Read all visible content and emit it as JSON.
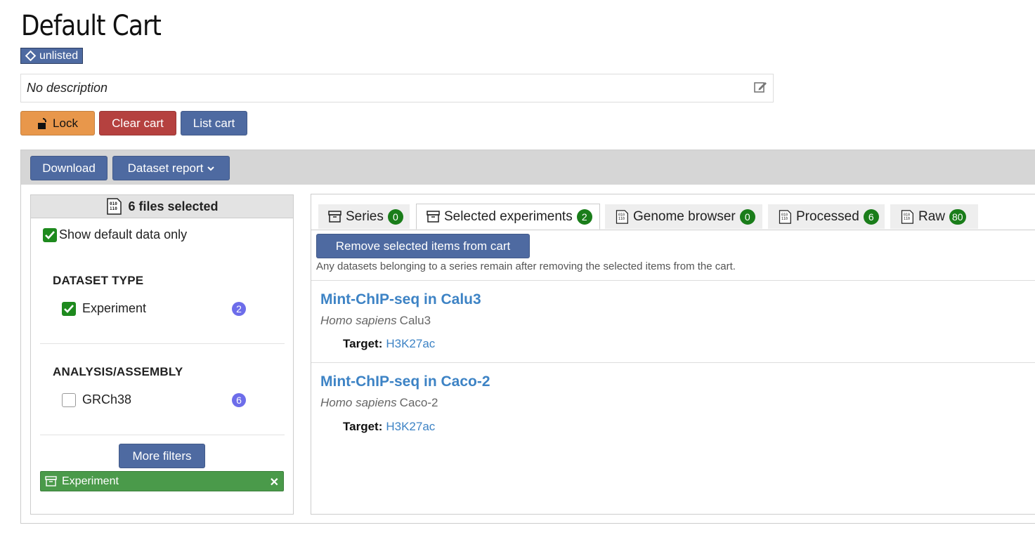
{
  "page": {
    "title": "Default Cart",
    "status": "unlisted",
    "description": "No description"
  },
  "actions": {
    "lock": "Lock",
    "clear": "Clear cart",
    "list": "List cart"
  },
  "toolbar": {
    "download": "Download",
    "dataset_report": "Dataset report"
  },
  "facets": {
    "files_selected": "6 files selected",
    "default_only_label": "Show default data only",
    "dataset_type": {
      "title": "DATASET TYPE",
      "items": [
        {
          "label": "Experiment",
          "count": "2",
          "checked": true
        }
      ]
    },
    "analysis": {
      "title": "ANALYSIS/ASSEMBLY",
      "items": [
        {
          "label": "GRCh38",
          "count": "6",
          "checked": false
        }
      ]
    },
    "more_filters": "More filters",
    "active_filter": "Experiment"
  },
  "tabs": [
    {
      "label": "Series",
      "count": "0",
      "icon": "archive-box-icon"
    },
    {
      "label": "Selected experiments",
      "count": "2",
      "icon": "archive-box-icon",
      "active": true
    },
    {
      "label": "Genome browser",
      "count": "0",
      "icon": "binary-file-icon"
    },
    {
      "label": "Processed",
      "count": "6",
      "icon": "binary-file-icon"
    },
    {
      "label": "Raw",
      "count": "80",
      "icon": "binary-file-icon"
    }
  ],
  "results": {
    "remove_button": "Remove selected items from cart",
    "note": "Any datasets belonging to a series remain after removing the selected items from the cart.",
    "target_label": "Target:",
    "items": [
      {
        "title": "Mint-ChIP-seq in Calu3",
        "organism": "Homo sapiens",
        "biosample": "Calu3",
        "target": "H3K27ac"
      },
      {
        "title": "Mint-ChIP-seq in Caco-2",
        "organism": "Homo sapiens",
        "biosample": "Caco-2",
        "target": "H3K27ac"
      }
    ]
  },
  "colors": {
    "primary": "#4e6aa1",
    "lock": "#e8974b",
    "danger": "#b5413f",
    "success": "#1a7d1a",
    "link": "#3d83c5",
    "facet_count": "#6d6dea"
  }
}
